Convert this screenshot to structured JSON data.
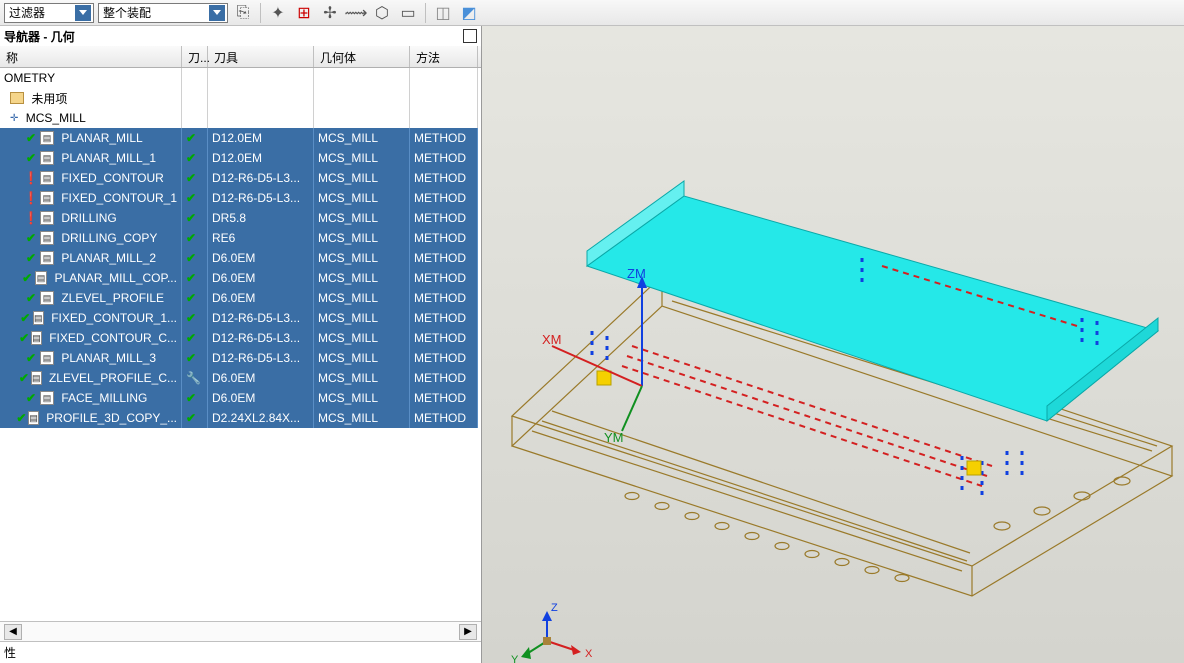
{
  "toolbar": {
    "combo1": "过滤器",
    "combo2": "整个装配"
  },
  "panel": {
    "title": "导航器 - 几何"
  },
  "columns": {
    "name": "称",
    "knife": "刀...",
    "tool": "刀具",
    "geom": "几何体",
    "method": "方法"
  },
  "tree": {
    "root": "OMETRY",
    "unused": "未用项",
    "mcs": "MCS_MILL"
  },
  "ops": [
    {
      "state": "check",
      "icon": "mill",
      "name": "PLANAR_MILL",
      "k": "check",
      "tool": "D12.0EM",
      "geom": "MCS_MILL",
      "method": "METHOD"
    },
    {
      "state": "check",
      "icon": "mill",
      "name": "PLANAR_MILL_1",
      "k": "check",
      "tool": "D12.0EM",
      "geom": "MCS_MILL",
      "method": "METHOD"
    },
    {
      "state": "warn",
      "icon": "contour",
      "name": "FIXED_CONTOUR",
      "k": "check",
      "tool": "D12-R6-D5-L3...",
      "geom": "MCS_MILL",
      "method": "METHOD"
    },
    {
      "state": "warn",
      "icon": "contour",
      "name": "FIXED_CONTOUR_1",
      "k": "check",
      "tool": "D12-R6-D5-L3...",
      "geom": "MCS_MILL",
      "method": "METHOD"
    },
    {
      "state": "warn",
      "icon": "drill",
      "name": "DRILLING",
      "k": "check",
      "tool": "DR5.8",
      "geom": "MCS_MILL",
      "method": "METHOD"
    },
    {
      "state": "check",
      "icon": "drill",
      "name": "DRILLING_COPY",
      "k": "check",
      "tool": "RE6",
      "geom": "MCS_MILL",
      "method": "METHOD"
    },
    {
      "state": "check",
      "icon": "mill",
      "name": "PLANAR_MILL_2",
      "k": "check",
      "tool": "D6.0EM",
      "geom": "MCS_MILL",
      "method": "METHOD"
    },
    {
      "state": "check",
      "icon": "mill",
      "name": "PLANAR_MILL_COP...",
      "k": "check",
      "tool": "D6.0EM",
      "geom": "MCS_MILL",
      "method": "METHOD"
    },
    {
      "state": "check",
      "icon": "zlevel",
      "name": "ZLEVEL_PROFILE",
      "k": "check",
      "tool": "D6.0EM",
      "geom": "MCS_MILL",
      "method": "METHOD"
    },
    {
      "state": "check",
      "icon": "contour",
      "name": "FIXED_CONTOUR_1...",
      "k": "check",
      "tool": "D12-R6-D5-L3...",
      "geom": "MCS_MILL",
      "method": "METHOD"
    },
    {
      "state": "check",
      "icon": "contour",
      "name": "FIXED_CONTOUR_C...",
      "k": "check",
      "tool": "D12-R6-D5-L3...",
      "geom": "MCS_MILL",
      "method": "METHOD"
    },
    {
      "state": "check",
      "icon": "mill",
      "name": "PLANAR_MILL_3",
      "k": "check",
      "tool": "D12-R6-D5-L3...",
      "geom": "MCS_MILL",
      "method": "METHOD"
    },
    {
      "state": "check",
      "icon": "zlevel",
      "name": "ZLEVEL_PROFILE_C...",
      "k": "wrench",
      "tool": "D6.0EM",
      "geom": "MCS_MILL",
      "method": "METHOD"
    },
    {
      "state": "check",
      "icon": "face",
      "name": "FACE_MILLING",
      "k": "check",
      "tool": "D6.0EM",
      "geom": "MCS_MILL",
      "method": "METHOD"
    },
    {
      "state": "check",
      "icon": "mill",
      "name": "PROFILE_3D_COPY_...",
      "k": "check",
      "tool": "D2.24XL2.84X...",
      "geom": "MCS_MILL",
      "method": "METHOD"
    }
  ],
  "bottom_tab": "性",
  "axes": {
    "z": "ZM",
    "x": "XM",
    "y": "YM",
    "gx": "X",
    "gy": "Y",
    "gz": "Z"
  }
}
